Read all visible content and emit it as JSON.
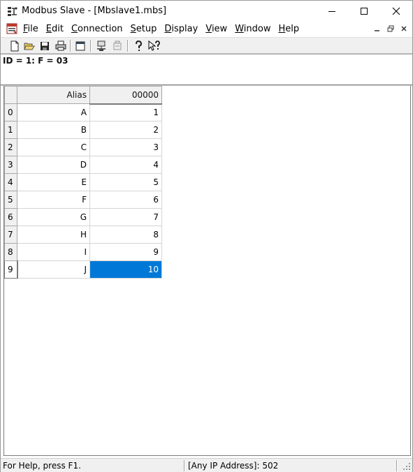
{
  "window": {
    "title": "Modbus Slave - [Mbslave1.mbs]"
  },
  "menu": {
    "items": [
      {
        "mnemonic": "F",
        "rest": "ile"
      },
      {
        "mnemonic": "E",
        "rest": "dit"
      },
      {
        "mnemonic": "C",
        "rest": "onnection"
      },
      {
        "mnemonic": "S",
        "rest": "etup"
      },
      {
        "mnemonic": "D",
        "rest": "isplay"
      },
      {
        "mnemonic": "V",
        "rest": "iew"
      },
      {
        "mnemonic": "W",
        "rest": "indow"
      },
      {
        "mnemonic": "H",
        "rest": "elp"
      }
    ]
  },
  "toolbar": {
    "icons": [
      "new-file-icon",
      "open-folder-icon",
      "save-icon",
      "print-icon",
      "window-icon",
      "connect-icon",
      "disconnect-icon",
      "help-icon",
      "context-help-icon"
    ]
  },
  "document": {
    "header": "ID = 1: F = 03",
    "columns": [
      "Alias",
      "00000"
    ],
    "rows": [
      {
        "index": "0",
        "alias": "A",
        "value": "1"
      },
      {
        "index": "1",
        "alias": "B",
        "value": "2"
      },
      {
        "index": "2",
        "alias": "C",
        "value": "3"
      },
      {
        "index": "3",
        "alias": "D",
        "value": "4"
      },
      {
        "index": "4",
        "alias": "E",
        "value": "5"
      },
      {
        "index": "5",
        "alias": "F",
        "value": "6"
      },
      {
        "index": "6",
        "alias": "G",
        "value": "7"
      },
      {
        "index": "7",
        "alias": "H",
        "value": "8"
      },
      {
        "index": "8",
        "alias": "I",
        "value": "9"
      },
      {
        "index": "9",
        "alias": "J",
        "value": "10"
      }
    ],
    "selected_row": 9,
    "selection_color": "#0078d7"
  },
  "status": {
    "help": "For Help, press F1.",
    "connection": "[Any IP Address]: 502"
  }
}
